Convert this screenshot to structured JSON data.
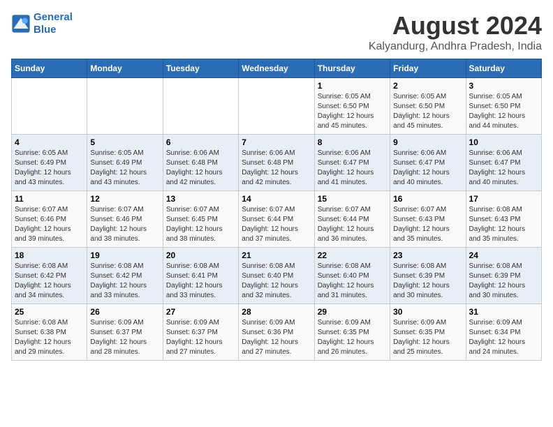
{
  "logo": {
    "line1": "General",
    "line2": "Blue"
  },
  "title": "August 2024",
  "subtitle": "Kalyandurg, Andhra Pradesh, India",
  "days_of_week": [
    "Sunday",
    "Monday",
    "Tuesday",
    "Wednesday",
    "Thursday",
    "Friday",
    "Saturday"
  ],
  "weeks": [
    [
      {
        "day": "",
        "info": ""
      },
      {
        "day": "",
        "info": ""
      },
      {
        "day": "",
        "info": ""
      },
      {
        "day": "",
        "info": ""
      },
      {
        "day": "1",
        "info": "Sunrise: 6:05 AM\nSunset: 6:50 PM\nDaylight: 12 hours\nand 45 minutes."
      },
      {
        "day": "2",
        "info": "Sunrise: 6:05 AM\nSunset: 6:50 PM\nDaylight: 12 hours\nand 45 minutes."
      },
      {
        "day": "3",
        "info": "Sunrise: 6:05 AM\nSunset: 6:50 PM\nDaylight: 12 hours\nand 44 minutes."
      }
    ],
    [
      {
        "day": "4",
        "info": "Sunrise: 6:05 AM\nSunset: 6:49 PM\nDaylight: 12 hours\nand 43 minutes."
      },
      {
        "day": "5",
        "info": "Sunrise: 6:05 AM\nSunset: 6:49 PM\nDaylight: 12 hours\nand 43 minutes."
      },
      {
        "day": "6",
        "info": "Sunrise: 6:06 AM\nSunset: 6:48 PM\nDaylight: 12 hours\nand 42 minutes."
      },
      {
        "day": "7",
        "info": "Sunrise: 6:06 AM\nSunset: 6:48 PM\nDaylight: 12 hours\nand 42 minutes."
      },
      {
        "day": "8",
        "info": "Sunrise: 6:06 AM\nSunset: 6:47 PM\nDaylight: 12 hours\nand 41 minutes."
      },
      {
        "day": "9",
        "info": "Sunrise: 6:06 AM\nSunset: 6:47 PM\nDaylight: 12 hours\nand 40 minutes."
      },
      {
        "day": "10",
        "info": "Sunrise: 6:06 AM\nSunset: 6:47 PM\nDaylight: 12 hours\nand 40 minutes."
      }
    ],
    [
      {
        "day": "11",
        "info": "Sunrise: 6:07 AM\nSunset: 6:46 PM\nDaylight: 12 hours\nand 39 minutes."
      },
      {
        "day": "12",
        "info": "Sunrise: 6:07 AM\nSunset: 6:46 PM\nDaylight: 12 hours\nand 38 minutes."
      },
      {
        "day": "13",
        "info": "Sunrise: 6:07 AM\nSunset: 6:45 PM\nDaylight: 12 hours\nand 38 minutes."
      },
      {
        "day": "14",
        "info": "Sunrise: 6:07 AM\nSunset: 6:44 PM\nDaylight: 12 hours\nand 37 minutes."
      },
      {
        "day": "15",
        "info": "Sunrise: 6:07 AM\nSunset: 6:44 PM\nDaylight: 12 hours\nand 36 minutes."
      },
      {
        "day": "16",
        "info": "Sunrise: 6:07 AM\nSunset: 6:43 PM\nDaylight: 12 hours\nand 35 minutes."
      },
      {
        "day": "17",
        "info": "Sunrise: 6:08 AM\nSunset: 6:43 PM\nDaylight: 12 hours\nand 35 minutes."
      }
    ],
    [
      {
        "day": "18",
        "info": "Sunrise: 6:08 AM\nSunset: 6:42 PM\nDaylight: 12 hours\nand 34 minutes."
      },
      {
        "day": "19",
        "info": "Sunrise: 6:08 AM\nSunset: 6:42 PM\nDaylight: 12 hours\nand 33 minutes."
      },
      {
        "day": "20",
        "info": "Sunrise: 6:08 AM\nSunset: 6:41 PM\nDaylight: 12 hours\nand 33 minutes."
      },
      {
        "day": "21",
        "info": "Sunrise: 6:08 AM\nSunset: 6:40 PM\nDaylight: 12 hours\nand 32 minutes."
      },
      {
        "day": "22",
        "info": "Sunrise: 6:08 AM\nSunset: 6:40 PM\nDaylight: 12 hours\nand 31 minutes."
      },
      {
        "day": "23",
        "info": "Sunrise: 6:08 AM\nSunset: 6:39 PM\nDaylight: 12 hours\nand 30 minutes."
      },
      {
        "day": "24",
        "info": "Sunrise: 6:08 AM\nSunset: 6:39 PM\nDaylight: 12 hours\nand 30 minutes."
      }
    ],
    [
      {
        "day": "25",
        "info": "Sunrise: 6:08 AM\nSunset: 6:38 PM\nDaylight: 12 hours\nand 29 minutes."
      },
      {
        "day": "26",
        "info": "Sunrise: 6:09 AM\nSunset: 6:37 PM\nDaylight: 12 hours\nand 28 minutes."
      },
      {
        "day": "27",
        "info": "Sunrise: 6:09 AM\nSunset: 6:37 PM\nDaylight: 12 hours\nand 27 minutes."
      },
      {
        "day": "28",
        "info": "Sunrise: 6:09 AM\nSunset: 6:36 PM\nDaylight: 12 hours\nand 27 minutes."
      },
      {
        "day": "29",
        "info": "Sunrise: 6:09 AM\nSunset: 6:35 PM\nDaylight: 12 hours\nand 26 minutes."
      },
      {
        "day": "30",
        "info": "Sunrise: 6:09 AM\nSunset: 6:35 PM\nDaylight: 12 hours\nand 25 minutes."
      },
      {
        "day": "31",
        "info": "Sunrise: 6:09 AM\nSunset: 6:34 PM\nDaylight: 12 hours\nand 24 minutes."
      }
    ]
  ]
}
